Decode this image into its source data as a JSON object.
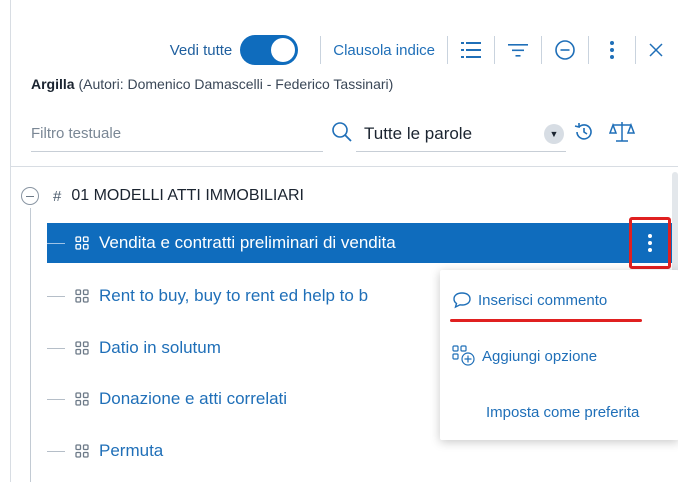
{
  "toolbar": {
    "show_all_label": "Vedi tutte",
    "show_all_on": true,
    "clause_index_label": "Clausola indice",
    "icons": [
      "list-icon",
      "filter-icon",
      "minus-circle-icon",
      "more-vertical-icon",
      "close-icon"
    ]
  },
  "header": {
    "name": "Argilla",
    "authors": "(Autori: Domenico Damascelli - Federico Tassinari)"
  },
  "filter": {
    "placeholder": "Filtro testuale",
    "value": "",
    "mode_selected": "Tutte le parole"
  },
  "tree": {
    "root_label": "01 MODELLI ATTI IMMOBILIARI",
    "items": [
      {
        "label": "Vendita e contratti preliminari di vendita",
        "selected": true
      },
      {
        "label": "Rent to buy, buy to rent ed help to b"
      },
      {
        "label": "Datio in solutum"
      },
      {
        "label": "Donazione e atti correlati"
      },
      {
        "label": "Permuta"
      }
    ]
  },
  "context_menu": {
    "items": [
      {
        "label": "Inserisci commento",
        "icon": "comment-icon"
      },
      {
        "label": "Aggiungi opzione",
        "icon": "add-option-icon"
      },
      {
        "label": "Imposta come preferita",
        "icon": ""
      }
    ]
  },
  "colors": {
    "accent": "#0f6cbd",
    "highlight_red": "#e02020",
    "link": "#1f6fb8"
  }
}
